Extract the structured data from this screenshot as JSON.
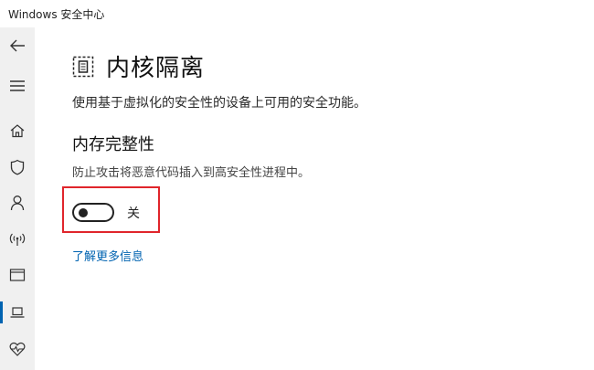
{
  "window": {
    "app_title": "Windows 安全中心"
  },
  "sidebar": {
    "items": [
      {
        "icon": "back-arrow-icon"
      },
      {
        "icon": "hamburger-menu-icon"
      },
      {
        "icon": "home-icon"
      },
      {
        "icon": "shield-icon"
      },
      {
        "icon": "person-icon"
      },
      {
        "icon": "wireless-icon"
      },
      {
        "icon": "app-browser-icon"
      },
      {
        "icon": "laptop-icon",
        "selected": true
      },
      {
        "icon": "heart-health-icon"
      }
    ],
    "accent_color": "#0063b1"
  },
  "main": {
    "page_title": "内核隔离",
    "page_icon": "core-isolation-icon",
    "page_description": "使用基于虚拟化的安全性的设备上可用的安全功能。",
    "memory_integrity": {
      "title": "内存完整性",
      "description": "防止攻击将恶意代码插入到高安全性进程中。",
      "toggle_state": "off",
      "toggle_label": "关"
    },
    "learn_more_link": "了解更多信息",
    "highlight_color": "#e0252b",
    "link_color": "#0063b1"
  }
}
